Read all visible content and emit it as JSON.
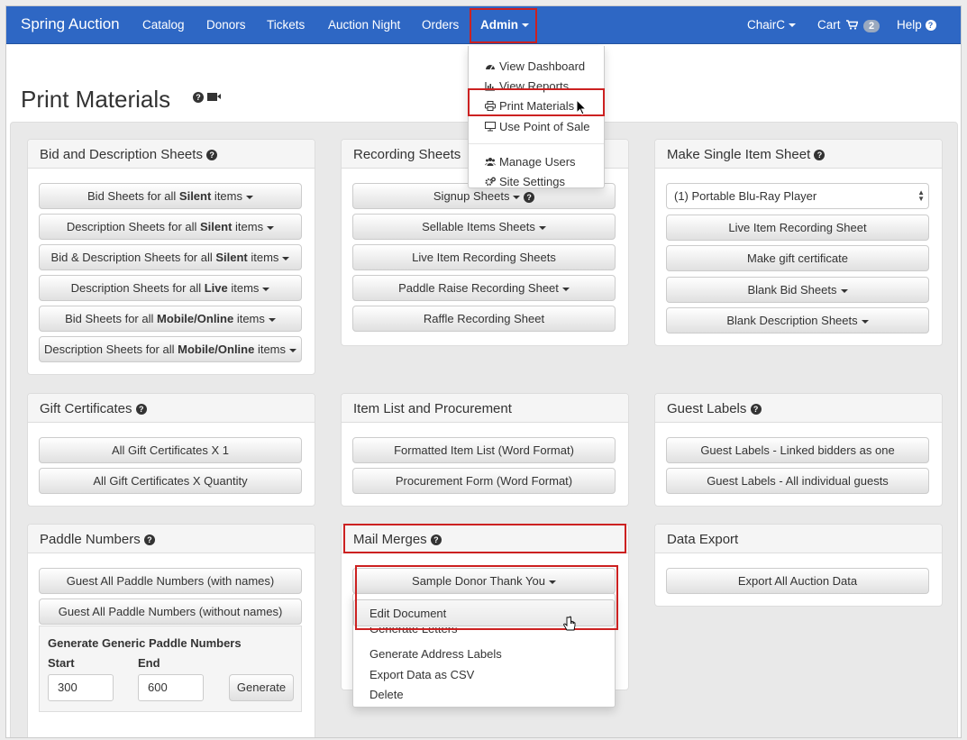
{
  "navbar": {
    "brand": "Spring Auction",
    "items": [
      "Catalog",
      "Donors",
      "Tickets",
      "Auction Night",
      "Orders",
      "Admin"
    ],
    "user": "ChairC",
    "cart": "Cart",
    "cart_count": "2",
    "help": "Help"
  },
  "admin_menu": {
    "items": [
      "View Dashboard",
      "View Reports",
      "Print Materials",
      "Use Point of Sale",
      "Manage Users",
      "Site Settings"
    ]
  },
  "page": {
    "title": "Print Materials"
  },
  "bid_sheets": {
    "heading": "Bid and Description Sheets",
    "buttons": [
      {
        "pre": "Bid Sheets for all ",
        "bold": "Silent",
        "post": " items"
      },
      {
        "pre": "Description Sheets for all ",
        "bold": "Silent",
        "post": " items"
      },
      {
        "pre": "Bid & Description Sheets for all ",
        "bold": "Silent",
        "post": " items"
      },
      {
        "pre": "Description Sheets for all ",
        "bold": "Live",
        "post": " items"
      },
      {
        "pre": "Bid Sheets for all ",
        "bold": "Mobile/Online",
        "post": " items"
      },
      {
        "pre": "Description Sheets for all ",
        "bold": "Mobile/Online",
        "post": " items"
      }
    ]
  },
  "recording": {
    "heading": "Recording Sheets",
    "buttons": [
      "Signup Sheets",
      "Sellable Items Sheets",
      "Live Item Recording Sheets",
      "Paddle Raise Recording Sheet",
      "Raffle Recording Sheet"
    ]
  },
  "single_item": {
    "heading": "Make Single Item Sheet",
    "selected_item": "(1) Portable Blu-Ray Player",
    "buttons": [
      "Live Item Recording Sheet",
      "Make gift certificate",
      "Blank Bid Sheets",
      "Blank Description Sheets"
    ]
  },
  "gift_certs": {
    "heading": "Gift Certificates",
    "buttons": [
      "All Gift Certificates X 1",
      "All Gift Certificates X Quantity"
    ]
  },
  "item_list": {
    "heading": "Item List and Procurement",
    "buttons": [
      "Formatted Item List (Word Format)",
      "Procurement Form (Word Format)"
    ]
  },
  "guest_labels": {
    "heading": "Guest Labels",
    "buttons": [
      "Guest Labels - Linked bidders as one",
      "Guest Labels - All individual guests"
    ]
  },
  "paddle": {
    "heading": "Paddle Numbers",
    "buttons": [
      "Guest All Paddle Numbers (with names)",
      "Guest All Paddle Numbers (without names)"
    ],
    "generic_title": "Generate Generic Paddle Numbers",
    "start_label": "Start",
    "end_label": "End",
    "start_value": "300",
    "end_value": "600",
    "generate": "Generate"
  },
  "mail_merges": {
    "heading": "Mail Merges",
    "template_button": "Sample Donor Thank You",
    "menu": [
      "Edit Document",
      "Generate Letters",
      "Generate Address Labels",
      "Export Data as CSV",
      "Delete"
    ]
  },
  "data_export": {
    "heading": "Data Export",
    "button": "Export All Auction Data"
  },
  "colors": {
    "navbar": "#2e67c4",
    "highlight": "#cc2121"
  }
}
